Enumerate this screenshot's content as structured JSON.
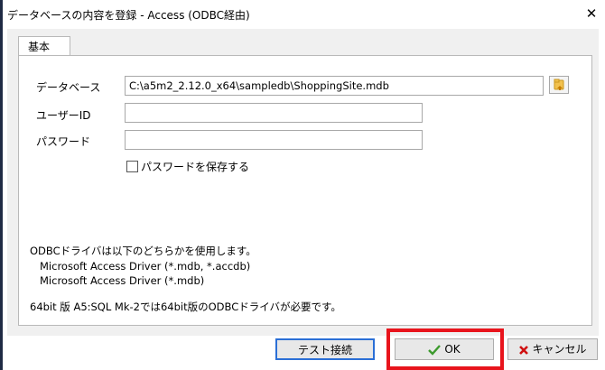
{
  "window": {
    "title": "データベースの内容を登録 - Access (ODBC経由)",
    "close_label": "✕"
  },
  "tabs": [
    {
      "label": "基本"
    }
  ],
  "form": {
    "database_label": "データベース",
    "database_value": "C:\\a5m2_2.12.0_x64\\sampledb\\ShoppingSite.mdb",
    "userid_label": "ユーザーID",
    "userid_value": "",
    "password_label": "パスワード",
    "password_value": "",
    "save_password_label": "パスワードを保存する",
    "save_password_checked": false
  },
  "info": {
    "line1": "ODBCドライバは以下のどちらかを使用します。",
    "line2": "Microsoft Access Driver (*.mdb, *.accdb)",
    "line3": "Microsoft Access Driver (*.mdb)",
    "line4": "64bit 版 A5:SQL Mk-2では64bit版のODBCドライバが必要です。"
  },
  "buttons": {
    "test_label": "テスト接続",
    "ok_label": "OK",
    "cancel_label": "キャンセル"
  },
  "icons": {
    "browse": "folder-icon",
    "ok": "checkmark-icon",
    "cancel": "x-icon"
  },
  "colors": {
    "highlight": "#e8141c",
    "ok_check": "#3c9a2d",
    "cancel_x": "#d01010"
  }
}
